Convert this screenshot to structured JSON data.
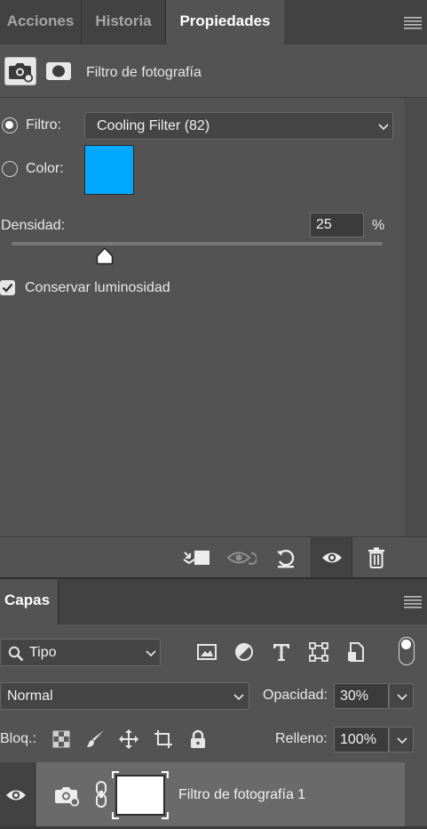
{
  "top_tabs": {
    "acciones": "Acciones",
    "historia": "Historia",
    "propiedades": "Propiedades"
  },
  "properties": {
    "title": "Filtro de fotografía",
    "filter_label": "Filtro:",
    "filter_value": "Cooling Filter (82)",
    "color_label": "Color:",
    "color_value": "#00a8ff",
    "density_label": "Densidad:",
    "density_value": "25",
    "density_unit": "%",
    "density_slider_percent": 25,
    "preserve_luminosity_label": "Conservar luminosidad",
    "preserve_luminosity_checked": true,
    "filter_mode_selected": "filter"
  },
  "properties_footer_icons": [
    "clip-to-layer-icon",
    "view-previous-state-icon",
    "reset-icon",
    "visibility-eye-icon",
    "trash-icon"
  ],
  "layers": {
    "tab_label": "Capas",
    "kind_filter_value": "Tipo",
    "blend_mode_value": "Normal",
    "opacity_label": "Opacidad:",
    "opacity_value": "30%",
    "lock_label": "Bloq.:",
    "fill_label": "Relleno:",
    "fill_value": "100%",
    "layer_items": [
      {
        "name": "Filtro de fotografía 1",
        "visible": true,
        "type": "photo-filter-adjustment"
      }
    ]
  },
  "colors": {
    "panel_bg": "#535353",
    "tabbar_bg": "#424242",
    "swatch": "#00a8ff",
    "selected_layer": "#6a6a6a"
  }
}
